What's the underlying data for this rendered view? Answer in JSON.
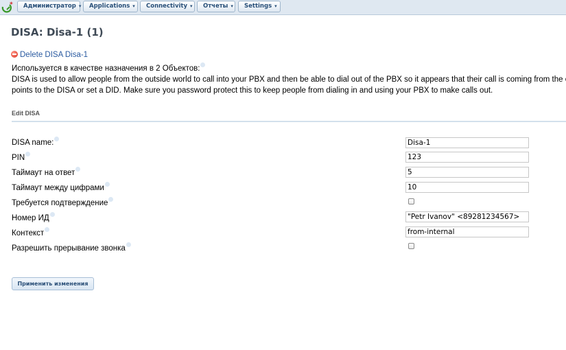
{
  "nav": {
    "items": [
      {
        "label": "Администратор"
      },
      {
        "label": "Applications"
      },
      {
        "label": "Connectivity"
      },
      {
        "label": "Отчеты"
      },
      {
        "label": "Settings"
      }
    ],
    "caret": "▾"
  },
  "page": {
    "title": "DISA: Disa-1 (1)",
    "delete_label": "Delete DISA Disa-1",
    "used_as_destination": "Используется в качестве назначения в 2 Объектов:",
    "description_line1": "DISA is used to allow people from the outside world to call into your PBX and then be able to dial out of the PBX so it appears that their call is coming from the office.",
    "description_line2": "points to the DISA or set a DID. Make sure you password protect this to keep people from dialing in and using your PBX to make calls out.",
    "section_header": "Edit DISA"
  },
  "form": {
    "disa_name": {
      "label": "DISA name:",
      "value": "Disa-1"
    },
    "pin": {
      "label": "PIN",
      "value": "123"
    },
    "response_timeout": {
      "label": "Таймаут на ответ",
      "value": "5"
    },
    "digit_timeout": {
      "label": "Таймаут между цифрами",
      "value": "10"
    },
    "require_confirmation": {
      "label": "Требуется подтверждение",
      "checked": false
    },
    "caller_id": {
      "label": "Номер ИД",
      "value": "\"Petr Ivanov\" <89281234567>"
    },
    "context": {
      "label": "Контекст",
      "value": "from-internal"
    },
    "allow_hangup": {
      "label": "Разрешить прерывание звонка",
      "checked": false
    },
    "submit_label": "Применить изменения"
  }
}
